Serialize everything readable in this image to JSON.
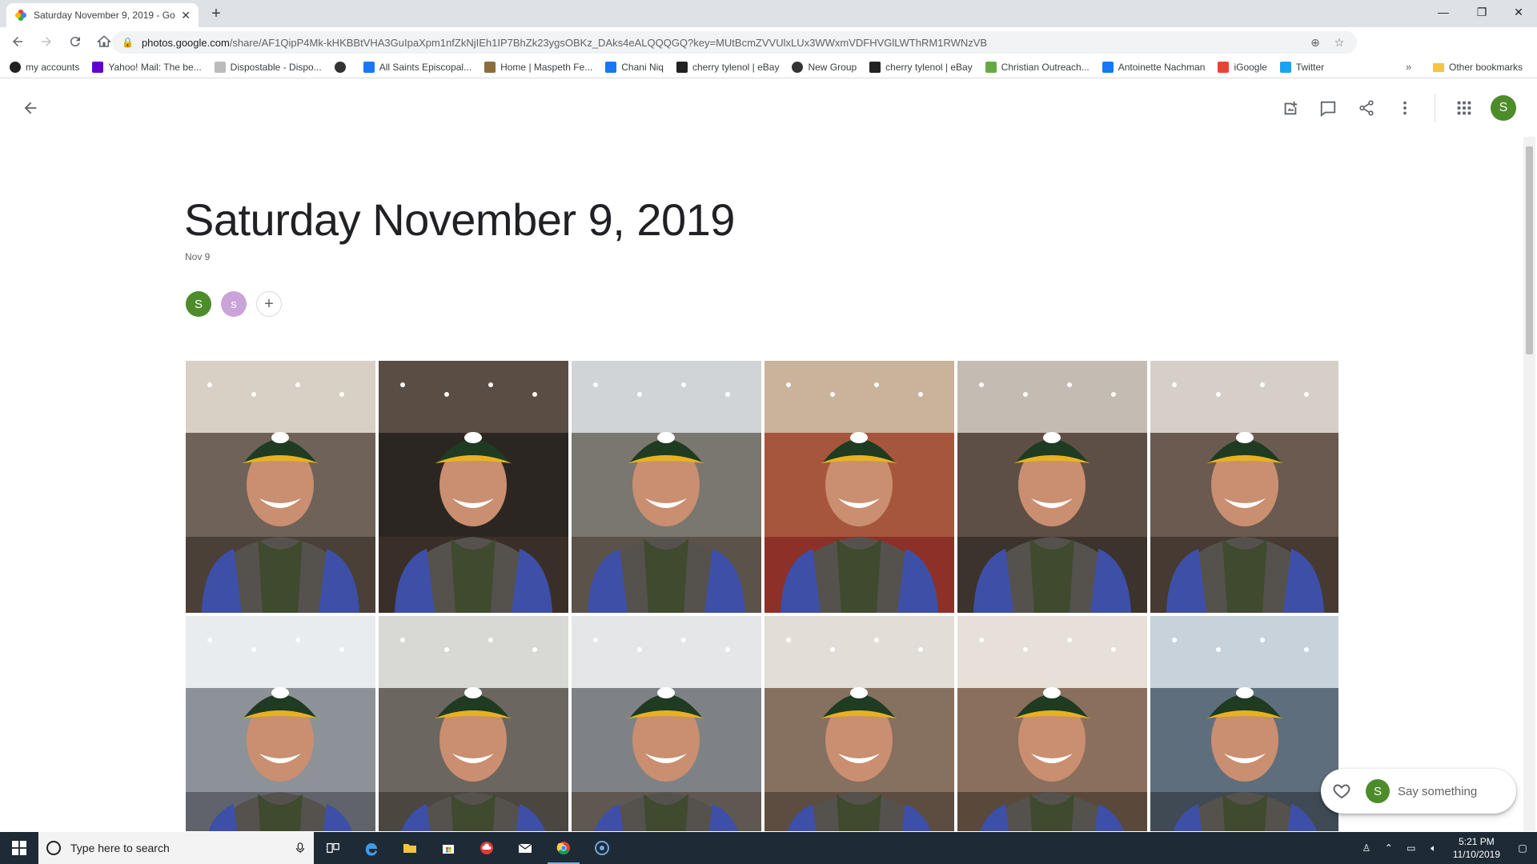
{
  "browser": {
    "tab_title": "Saturday November 9, 2019 - Go",
    "new_tab": "+",
    "url_host": "photos.google.com",
    "url_path": "/share/AF1QipP4Mk-kHKBBtVHA3GuIpaXpm1nfZkNjIEh1IP7BhZk23ygsOBKz_DAks4eALQQQGQ?key=MUtBcmZVVUlxLUx3WWxmVDFHVGlLWThRM1RWNzVB",
    "profile_initial": "S"
  },
  "bookmarks": [
    {
      "label": "my accounts",
      "icon": "globe-icon",
      "color": "#222"
    },
    {
      "label": "Yahoo! Mail: The be...",
      "icon": "yahoo-icon",
      "color": "#6001d2"
    },
    {
      "label": "Dispostable - Dispo...",
      "icon": "page-icon",
      "color": "#bbb"
    },
    {
      "label": "",
      "icon": "globe-icon",
      "color": "#333"
    },
    {
      "label": "All Saints Episcopal...",
      "icon": "facebook-icon",
      "color": "#1877f2"
    },
    {
      "label": "Home | Maspeth Fe...",
      "icon": "badge-icon",
      "color": "#8a6d3b"
    },
    {
      "label": "Chani Niq",
      "icon": "facebook-icon",
      "color": "#1877f2"
    },
    {
      "label": "cherry tylenol | eBay",
      "icon": "ebay-icon",
      "color": "#222"
    },
    {
      "label": "New Group",
      "icon": "globe-icon",
      "color": "#333"
    },
    {
      "label": "cherry tylenol | eBay",
      "icon": "ebay-icon",
      "color": "#222"
    },
    {
      "label": "Christian Outreach...",
      "icon": "church-icon",
      "color": "#6a4"
    },
    {
      "label": "Antoinette Nachman",
      "icon": "facebook-icon",
      "color": "#1877f2"
    },
    {
      "label": "iGoogle",
      "icon": "google-icon",
      "color": "#ea4335"
    },
    {
      "label": "Twitter",
      "icon": "twitter-icon",
      "color": "#1da1f2"
    }
  ],
  "bookmarks_more": "»",
  "other_bookmarks": "Other bookmarks",
  "album": {
    "title": "Saturday November 9, 2019",
    "date": "Nov 9",
    "members": [
      {
        "initial": "S",
        "color": "#4c8c2b"
      },
      {
        "initial": "s",
        "color": "#c9a3d9"
      }
    ],
    "add_member": "+"
  },
  "account_initial": "S",
  "photos": [
    {
      "bg": "#6e6259",
      "floor": "#4a4038",
      "ceiling": "#d8d0c4"
    },
    {
      "bg": "#2c2622",
      "floor": "#3a2f28",
      "ceiling": "#5a4d44"
    },
    {
      "bg": "#7a7670",
      "floor": "#5b524a",
      "ceiling": "#d0d4d6"
    },
    {
      "bg": "#a6563d",
      "floor": "#8d3128",
      "ceiling": "#c9b39a"
    },
    {
      "bg": "#5d4f46",
      "floor": "#3b332c",
      "ceiling": "#c4bcb2"
    },
    {
      "bg": "#6a5a50",
      "floor": "#463a32",
      "ceiling": "#d6cfc8"
    },
    {
      "bg": "#8c9298",
      "floor": "#60646a",
      "ceiling": "#e8ecef"
    },
    {
      "bg": "#6c6660",
      "floor": "#4c4640",
      "ceiling": "#d8d8d4"
    },
    {
      "bg": "#7e8286",
      "floor": "#5e5850",
      "ceiling": "#e4e6e8"
    },
    {
      "bg": "#86705f",
      "floor": "#5d4d40",
      "ceiling": "#e2ddd6"
    },
    {
      "bg": "#8a6f5c",
      "floor": "#5a483b",
      "ceiling": "#e6e0d8"
    },
    {
      "bg": "#5e6e7c",
      "floor": "#3f4a54",
      "ceiling": "#c8d2da"
    }
  ],
  "comment": {
    "avatar_initial": "S",
    "placeholder": "Say something"
  },
  "taskbar": {
    "search_placeholder": "Type here to search",
    "time": "5:21 PM",
    "date": "11/10/2019"
  }
}
